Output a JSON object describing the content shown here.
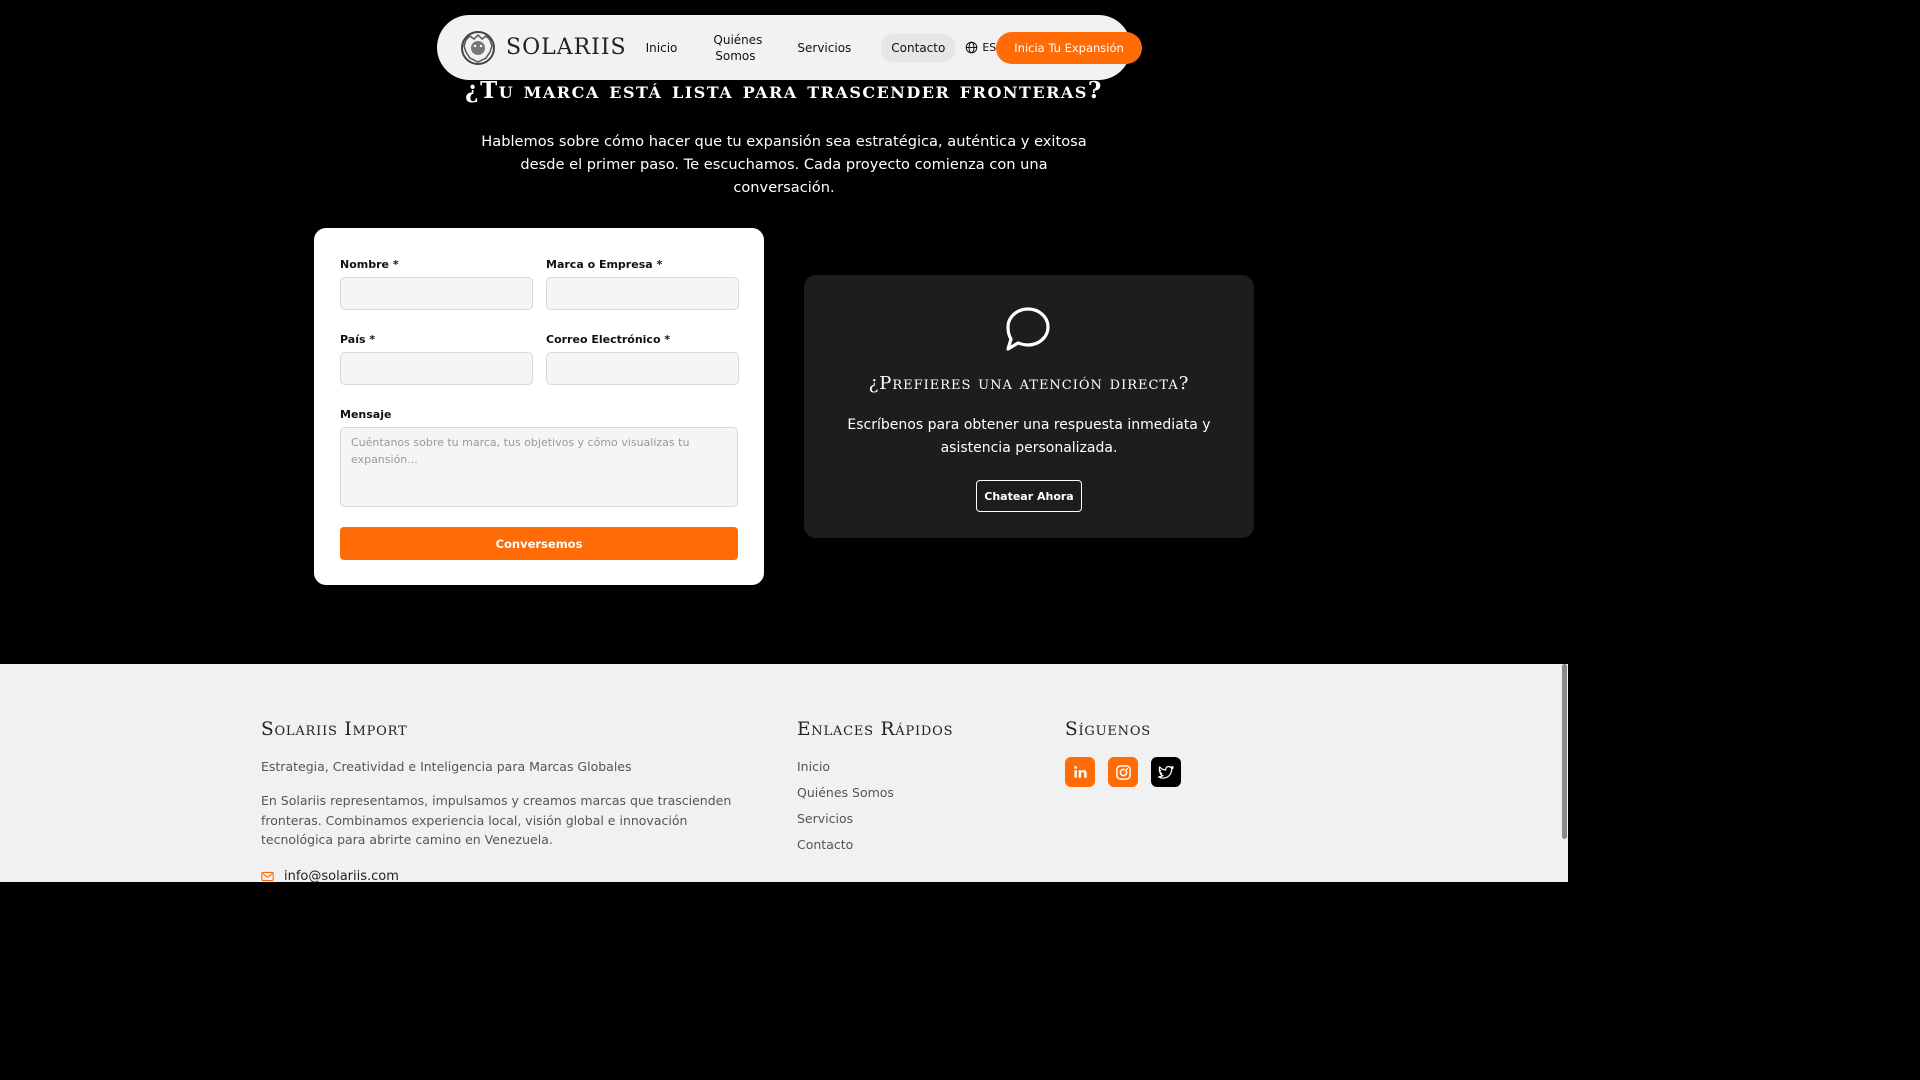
{
  "nav": {
    "logo_text": "SOLARIIS",
    "links": [
      {
        "label": "Inicio"
      },
      {
        "label": "Quiénes Somos"
      },
      {
        "label": "Servicios"
      },
      {
        "label": "Contacto"
      }
    ],
    "language": "ES",
    "cta_label": "Inicia Tu Expansión"
  },
  "hero": {
    "title": "¿Tu marca está lista para trascender fronteras?",
    "subtitle": "Hablemos sobre cómo hacer que tu expansión sea estratégica, auténtica y exitosa desde el primer paso. Te escuchamos. Cada proyecto comienza con una conversación."
  },
  "form": {
    "name_label": "Nombre *",
    "brand_label": "Marca o Empresa *",
    "country_label": "País *",
    "email_label": "Correo Electrónico *",
    "message_label": "Mensaje",
    "message_placeholder": "Cuéntanos sobre tu marca, tus objetivos y cómo visualizas tu expansión...",
    "submit_label": "Conversemos"
  },
  "chat": {
    "title": "¿Prefieres una atención directa?",
    "text": "Escríbenos para obtener una respuesta inmediata y asistencia personalizada.",
    "button_label": "Chatear Ahora"
  },
  "footer": {
    "brand_title": "Solariis Import",
    "tagline": "Estrategia, Creatividad e Inteligencia para Marcas Globales",
    "description": "En Solariis representamos, impulsamos y creamos marcas que trascienden fronteras. Combinamos experiencia local, visión global e innovación tecnológica para abrirte camino en Venezuela.",
    "email": "info@solariis.com",
    "links_title": "Enlaces Rápidos",
    "links": [
      "Inicio",
      "Quiénes Somos",
      "Servicios",
      "Contacto"
    ],
    "social_title": "Síguenos",
    "social_icons": [
      "linkedin-icon",
      "instagram-icon",
      "twitter-icon"
    ]
  },
  "colors": {
    "accent": "#ff6b06",
    "background": "#000000",
    "chat_card": "#1d1d1d",
    "footer_bg": "#f1f1f1"
  }
}
